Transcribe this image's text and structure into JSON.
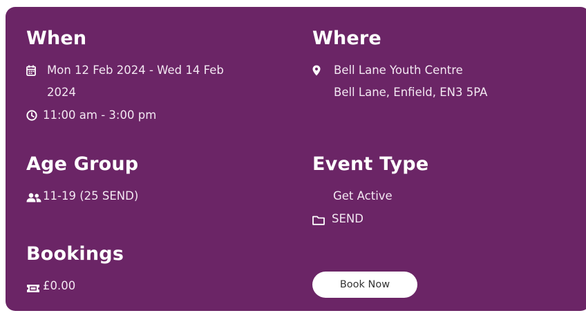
{
  "when": {
    "heading": "When",
    "date_line1": "Mon 12 Feb 2024 - Wed 14 Feb",
    "date_line2": "2024",
    "time": "11:00 am - 3:00 pm"
  },
  "where": {
    "heading": "Where",
    "venue": "Bell Lane Youth Centre",
    "address": "Bell Lane, Enfield, EN3 5PA"
  },
  "age_group": {
    "heading": "Age Group",
    "value": "11-19 (25 SEND)"
  },
  "event_type": {
    "heading": "Event Type",
    "category": "Get Active",
    "tag": "SEND"
  },
  "bookings": {
    "heading": "Bookings",
    "price": "£0.00",
    "book_button": "Book Now"
  },
  "icons": {
    "date": "calendar-icon",
    "time": "clock-icon",
    "location": "map-pin-icon",
    "age": "users-icon",
    "tag": "folder-icon",
    "price": "ticket-icon"
  },
  "colors": {
    "card_background": "#6b2566",
    "text": "#ffffff",
    "button_background": "#ffffff",
    "button_text": "#333333"
  }
}
